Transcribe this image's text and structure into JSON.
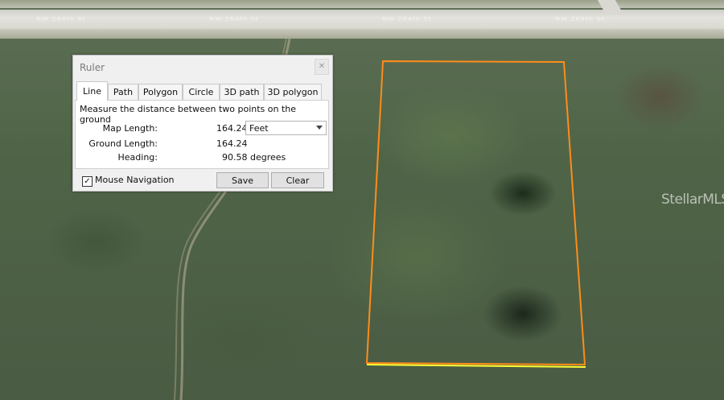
{
  "map": {
    "streets": [
      "NW 264th St",
      "NW 264th St",
      "NW 264th St",
      "NW 264th St"
    ],
    "watermark": "StellarMLS"
  },
  "ruler": {
    "title": "Ruler",
    "close_icon": "close-icon",
    "tabs": [
      "Line",
      "Path",
      "Polygon",
      "Circle",
      "3D path",
      "3D polygon"
    ],
    "active_tab": "Line",
    "description": "Measure the distance between two points on the ground",
    "map_length_label": "Map Length:",
    "map_length_value": "164.24",
    "unit": "Feet",
    "ground_length_label": "Ground Length:",
    "ground_length_value": "164.24",
    "heading_label": "Heading:",
    "heading_value": "90.58 degrees",
    "mouse_navigation_label": "Mouse Navigation",
    "mouse_navigation_checked": "✓",
    "save_label": "Save",
    "clear_label": "Clear"
  },
  "colors": {
    "parcel_outline": "#ff8c1a",
    "measure_line": "#ffff33"
  }
}
